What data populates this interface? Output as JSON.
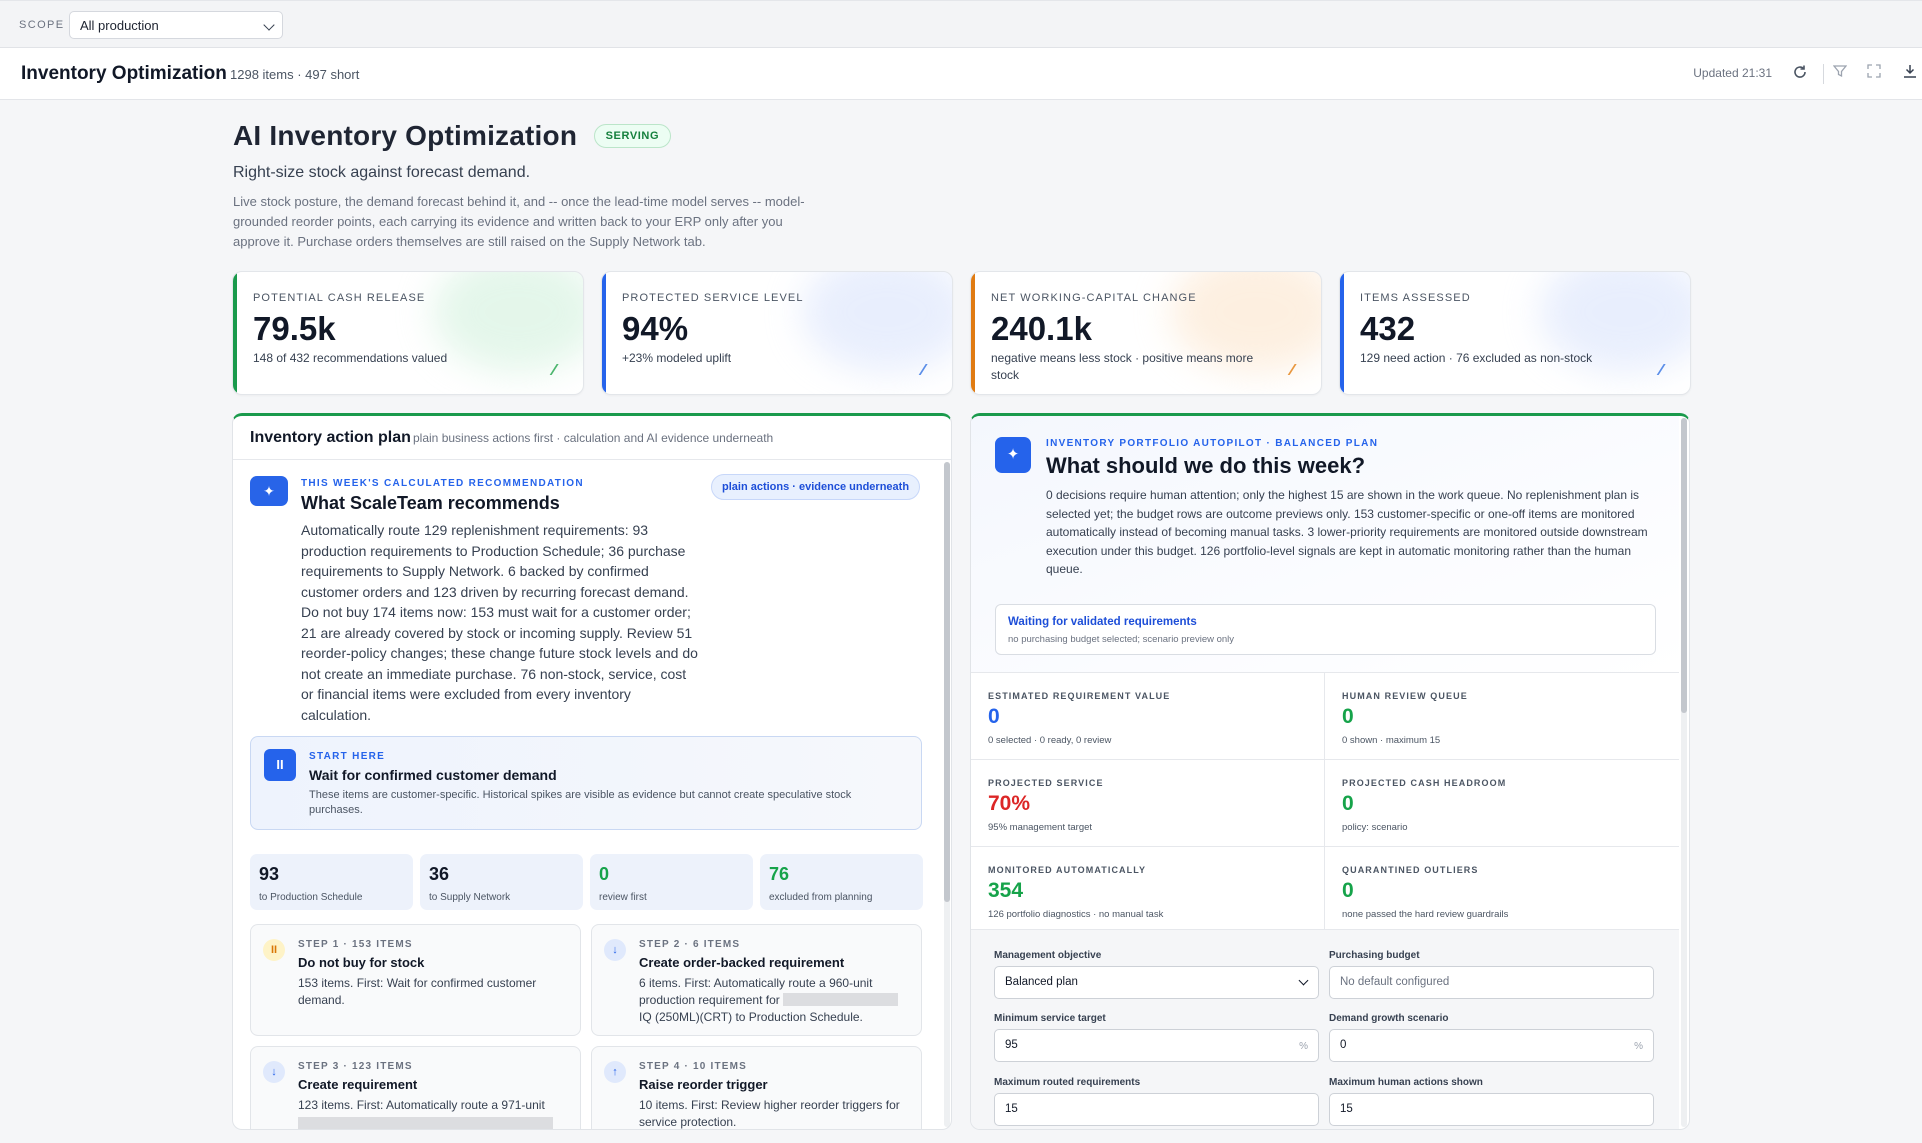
{
  "scope": {
    "label": "SCOPE",
    "value": "All production"
  },
  "header": {
    "title": "Inventory Optimization",
    "meta": "1298 items · 497 short",
    "updated": "Updated 21:31",
    "icons": [
      "refresh-icon",
      "filter-icon",
      "expand-icon",
      "download-icon"
    ]
  },
  "hero": {
    "title": "AI Inventory Optimization",
    "badge": "SERVING",
    "subtitle": "Right-size stock against forecast demand.",
    "description": "Live stock posture, the demand forecast behind it, and -- once the lead-time model serves -- model-grounded reorder points, each carrying its evidence and written back to your ERP only after you approve it. Purchase orders themselves are still raised on the Supply Network tab."
  },
  "kpis": [
    {
      "label": "POTENTIAL CASH RELEASE",
      "value": "79.5k",
      "note": "148 of 432 recommendations valued",
      "color": "#1a9a4c"
    },
    {
      "label": "PROTECTED SERVICE LEVEL",
      "value": "94%",
      "note": "+23% modeled uplift",
      "color": "#2563eb"
    },
    {
      "label": "NET WORKING-CAPITAL CHANGE",
      "value": "240.1k",
      "note": "negative means less stock · positive means more stock",
      "color": "#e07b12"
    },
    {
      "label": "ITEMS ASSESSED",
      "value": "432",
      "note": "129 need action · 76 excluded as non-stock",
      "color": "#2563eb"
    }
  ],
  "action_plan": {
    "title": "Inventory action plan",
    "subtitle": "plain business actions first · calculation and AI evidence underneath",
    "rec_eyebrow": "THIS WEEK'S CALCULATED RECOMMENDATION",
    "rec_title": "What ScaleTeam recommends",
    "rec_pill": "plain actions · evidence underneath",
    "rec_body": "Automatically route 129 replenishment requirements: 93 production requirements to Production Schedule; 36 purchase requirements to Supply Network. 6 backed by confirmed customer orders and 123 driven by recurring forecast demand. Do not buy 174 items now: 153 must wait for a customer order; 21 are already covered by stock or incoming supply. Review 51 reorder-policy changes; these change future stock levels and do not create an immediate purchase. 76 non-stock, service, cost or financial items were excluded from every inventory calculation.",
    "start": {
      "eyebrow": "START HERE",
      "title": "Wait for confirmed customer demand",
      "desc": "These items are customer-specific. Historical spikes are visible as evidence but cannot create speculative stock purchases."
    },
    "counts": [
      {
        "n": "93",
        "t": "to Production Schedule",
        "color": "#111827"
      },
      {
        "n": "36",
        "t": "to Supply Network",
        "color": "#111827"
      },
      {
        "n": "0",
        "t": "review first",
        "color": "#16a34a"
      },
      {
        "n": "76",
        "t": "excluded from planning",
        "color": "#16a34a"
      }
    ],
    "steps": [
      {
        "label": "STEP 1 · 153 ITEMS",
        "title": "Do not buy for stock",
        "desc": "153 items. First: Wait for confirmed customer demand.",
        "icon": "pause-icon"
      },
      {
        "label": "STEP 2 · 6 ITEMS",
        "title": "Create order-backed requirement",
        "desc_a": "6 items. First: Automatically route a 960-unit production requirement for",
        "desc_b": "IQ (250ML)(CRT) to Production Schedule.",
        "icon": "arrow-down-icon"
      },
      {
        "label": "STEP 3 · 123 ITEMS",
        "title": "Create requirement",
        "desc": "123 items. First: Automatically route a 971-unit",
        "icon": "arrow-down-icon"
      },
      {
        "label": "STEP 4 · 10 ITEMS",
        "title": "Raise reorder trigger",
        "desc": "10 items. First: Review higher reorder triggers for service protection.",
        "icon": "arrow-up-icon"
      }
    ]
  },
  "autopilot": {
    "eyebrow": "INVENTORY PORTFOLIO AUTOPILOT · BALANCED PLAN",
    "title": "What should we do this week?",
    "desc": "0 decisions require human attention; only the highest 15 are shown in the work queue. No replenishment plan is selected yet; the budget rows are outcome previews only. 153 customer-specific or one-off items are monitored automatically instead of becoming manual tasks. 3 lower-priority requirements are monitored outside downstream execution under this budget. 126 portfolio-level signals are kept in automatic monitoring rather than the human queue.",
    "wait_title": "Waiting for validated requirements",
    "wait_sub": "no purchasing budget selected; scenario preview only",
    "metrics": [
      {
        "label": "ESTIMATED REQUIREMENT VALUE",
        "value": "0",
        "sub": "0 selected · 0 ready, 0 review",
        "color": "#2563eb"
      },
      {
        "label": "HUMAN REVIEW QUEUE",
        "value": "0",
        "sub": "0 shown · maximum 15",
        "color": "#16a34a"
      },
      {
        "label": "PROJECTED SERVICE",
        "value": "70%",
        "sub": "95% management target",
        "color": "#dc2626"
      },
      {
        "label": "PROJECTED CASH HEADROOM",
        "value": "0",
        "sub": "policy: scenario",
        "color": "#16a34a"
      },
      {
        "label": "MONITORED AUTOMATICALLY",
        "value": "354",
        "sub": "126 portfolio diagnostics · no manual task",
        "color": "#16a34a"
      },
      {
        "label": "QUARANTINED OUTLIERS",
        "value": "0",
        "sub": "none passed the hard review guardrails",
        "color": "#16a34a"
      }
    ],
    "form": {
      "objective_label": "Management objective",
      "objective_value": "Balanced plan",
      "budget_label": "Purchasing budget",
      "budget_placeholder": "No default configured",
      "service_label": "Minimum service target",
      "service_value": "95",
      "growth_label": "Demand growth scenario",
      "growth_value": "0",
      "unit": "%",
      "routed_label": "Maximum routed requirements",
      "routed_value": "15",
      "actions_label": "Maximum human actions shown",
      "actions_value": "15"
    }
  }
}
